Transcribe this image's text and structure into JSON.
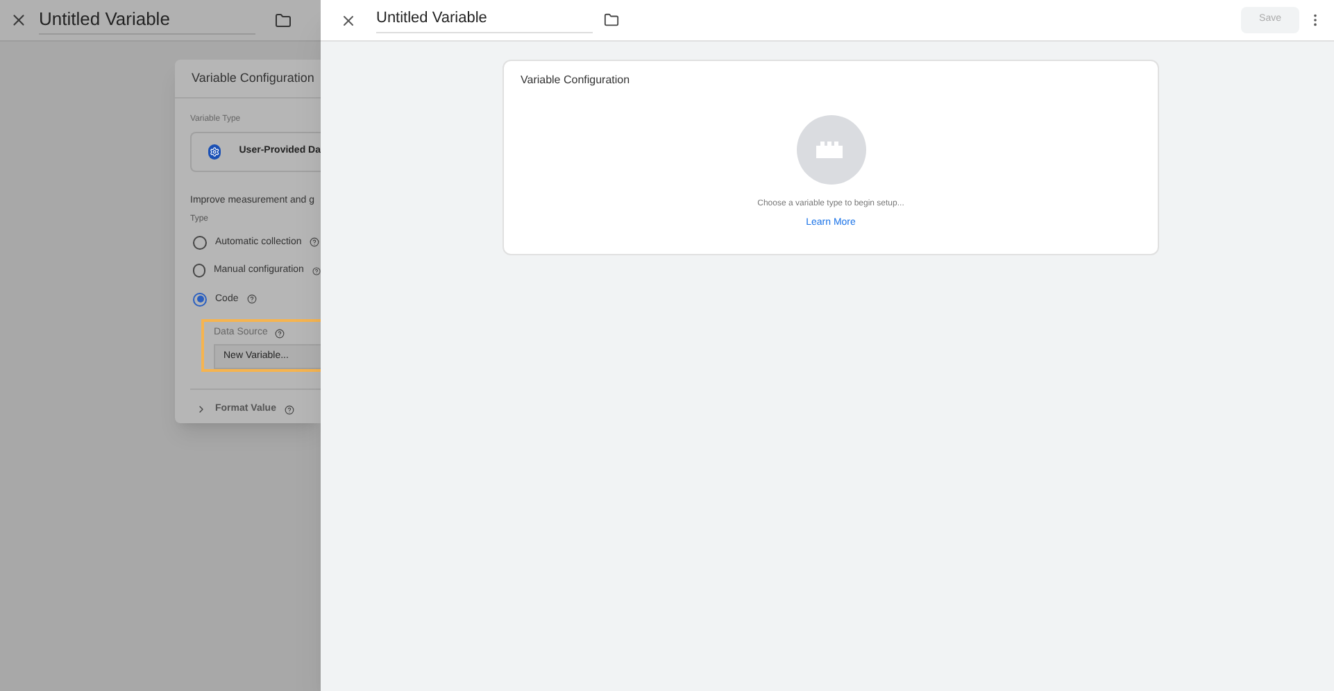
{
  "background_panel": {
    "title": "Untitled Variable",
    "card": {
      "title": "Variable Configuration",
      "variable_type_label": "Variable Type",
      "variable_type": "User-Provided Da",
      "description": "Improve measurement and g",
      "type_label": "Type",
      "options": [
        {
          "label": "Automatic collection",
          "selected": false
        },
        {
          "label": "Manual configuration",
          "selected": false
        },
        {
          "label": "Code",
          "selected": true
        }
      ],
      "data_source": {
        "label": "Data Source",
        "value": "New Variable..."
      },
      "format_value": {
        "label": "Format Value",
        "expanded": false
      }
    }
  },
  "panel": {
    "title": "Untitled Variable",
    "save": "Save",
    "card": {
      "title": "Variable Configuration",
      "hint": "Choose a variable type to begin setup...",
      "link": "Learn More"
    }
  }
}
